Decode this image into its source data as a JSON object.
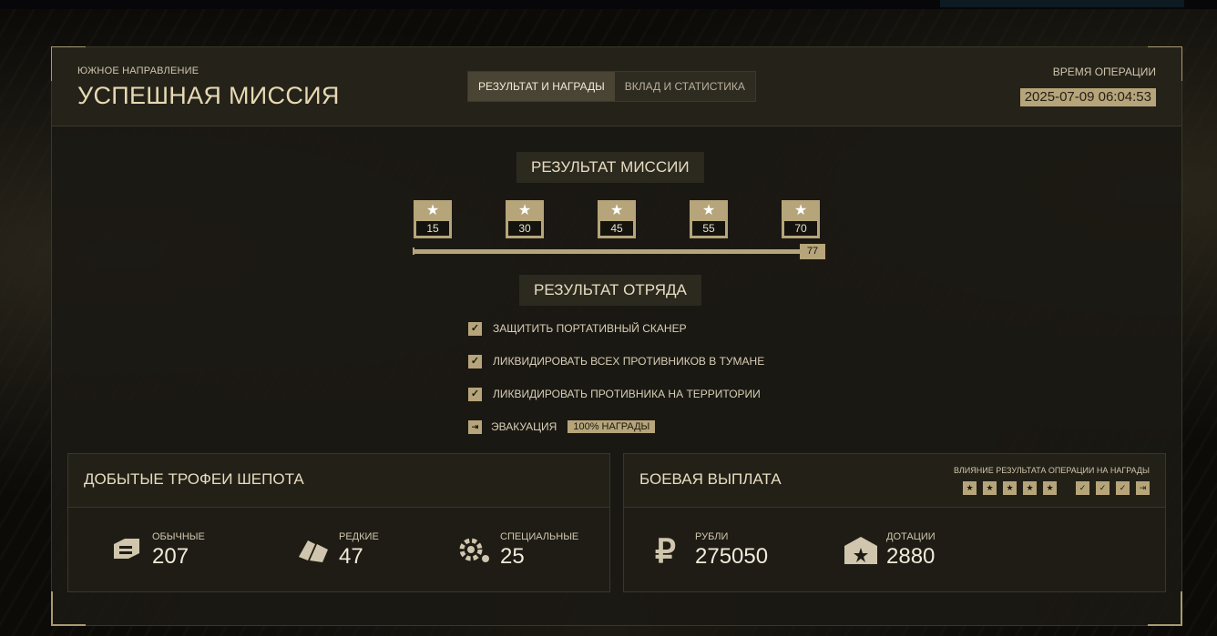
{
  "header": {
    "subtitle": "ЮЖНОЕ НАПРАВЛЕНИЕ",
    "title": "УСПЕШНАЯ МИССИЯ",
    "op_time_label": "ВРЕМЯ ОПЕРАЦИИ",
    "op_time_value": "2025-07-09 06:04:53"
  },
  "tabs": [
    {
      "label": "РЕЗУЛЬТАТ И НАГРАДЫ",
      "active": true
    },
    {
      "label": "ВКЛАД И СТАТИСТИКА",
      "active": false
    }
  ],
  "mission": {
    "title": "РЕЗУЛЬТАТ МИССИИ",
    "thresholds": [
      "15",
      "30",
      "45",
      "55",
      "70"
    ],
    "score": "77",
    "progress_fraction": 1.0
  },
  "squad": {
    "title": "РЕЗУЛЬТАТ ОТРЯДА",
    "objectives": [
      {
        "label": "ЗАЩИТИТЬ ПОРТАТИВНЫЙ СКАНЕР",
        "icon": "check-icon"
      },
      {
        "label": "ЛИКВИДИРОВАТЬ ВСЕХ ПРОТИВНИКОВ В ТУМАНЕ",
        "icon": "check-icon"
      },
      {
        "label": "ЛИКВИДИРОВАТЬ ПРОТИВНИКА НА ТЕРРИТОРИИ",
        "icon": "check-icon"
      }
    ],
    "evac": {
      "label": "ЭВАКУАЦИЯ",
      "badge": "100% НАГРАДЫ",
      "icon": "exit-icon"
    }
  },
  "trophies": {
    "title": "ДОБЫТЫЕ ТРОФЕИ ШЕПОТА",
    "items": [
      {
        "label": "ОБЫЧНЫЕ",
        "value": "207",
        "icon": "common-trophy-icon"
      },
      {
        "label": "РЕДКИЕ",
        "value": "47",
        "icon": "rare-trophy-icon"
      },
      {
        "label": "СПЕЦИАЛЬНЫЕ",
        "value": "25",
        "icon": "special-trophy-icon"
      }
    ]
  },
  "payout": {
    "title": "БОЕВАЯ ВЫПЛАТА",
    "influence_label": "ВЛИЯНИЕ РЕЗУЛЬТАТА ОПЕРАЦИИ НА НАГРАДЫ",
    "items": [
      {
        "label": "РУБЛИ",
        "value": "275050",
        "icon": "ruble-icon"
      },
      {
        "label": "ДОТАЦИИ",
        "value": "2880",
        "icon": "subsidy-icon"
      }
    ]
  },
  "colors": {
    "accent": "#b6a57a",
    "panel": "#1e1c15",
    "text": "#e6dcc0"
  }
}
